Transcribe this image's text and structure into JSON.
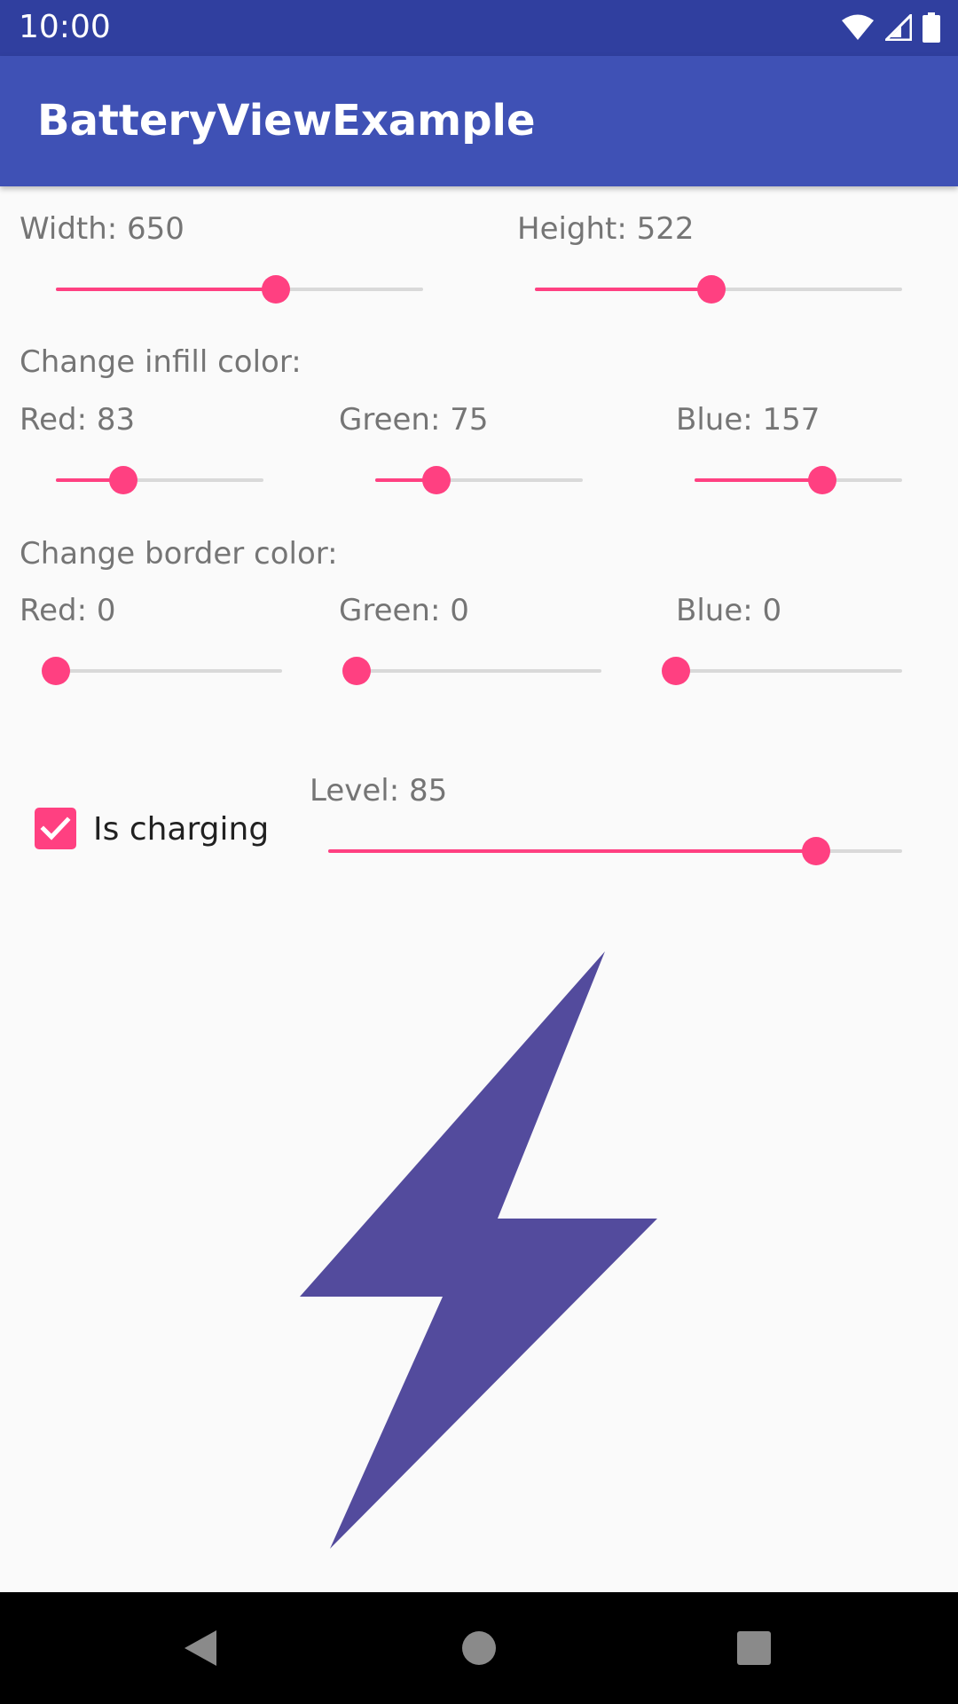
{
  "status_bar": {
    "time": "10:00",
    "icons": [
      "wifi-icon",
      "signal-icon",
      "battery-icon"
    ]
  },
  "app_bar": {
    "title": "BatteryViewExample"
  },
  "size": {
    "width": {
      "label": "Width: 650",
      "value": 650,
      "fraction": 0.6
    },
    "height": {
      "label": "Height: 522",
      "value": 522,
      "fraction": 0.48
    }
  },
  "infill": {
    "heading": "Change infill color:",
    "red": {
      "label": "Red: 83",
      "value": 83,
      "fraction": 0.325
    },
    "green": {
      "label": "Green: 75",
      "value": 75,
      "fraction": 0.294
    },
    "blue": {
      "label": "Blue: 157",
      "value": 157,
      "fraction": 0.616
    }
  },
  "border": {
    "heading": "Change border color:",
    "red": {
      "label": "Red: 0",
      "value": 0,
      "fraction": 0
    },
    "green": {
      "label": "Green: 0",
      "value": 0,
      "fraction": 0
    },
    "blue": {
      "label": "Blue: 0",
      "value": 0,
      "fraction": 0
    }
  },
  "charging": {
    "label": "Is charging",
    "checked": true
  },
  "level": {
    "label": "Level: 85",
    "value": 85,
    "fraction": 0.85
  },
  "colors": {
    "accent": "#ff4081",
    "primary": "#3f51b5",
    "primary_dark": "#303f9f",
    "bolt_fill": "#534b9d"
  },
  "nav_bar": {
    "buttons": [
      "back-icon",
      "home-icon",
      "recents-icon"
    ]
  }
}
